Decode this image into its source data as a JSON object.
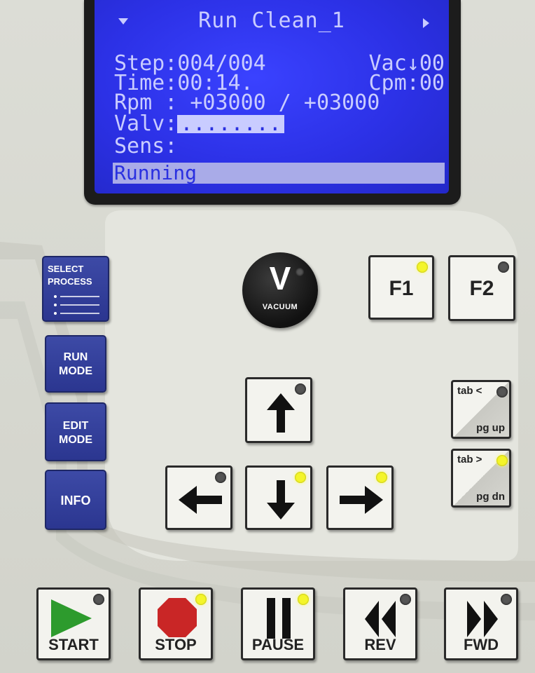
{
  "display": {
    "title": "Run Clean_1",
    "step_label": "Step:004/004",
    "vac_label": "Vac↓00",
    "time_label": "Time:00:14.",
    "cpm_label": "Cpm:00",
    "rpm_label": "Rpm : +03000 / +03000",
    "valv_label": "Valv:",
    "valv_value": "........",
    "sens_label": "Sens:",
    "status": "Running"
  },
  "side_keys": {
    "select_process": [
      "SELECT",
      "PROCESS"
    ],
    "run_mode": [
      "RUN",
      "MODE"
    ],
    "edit_mode": [
      "EDIT",
      "MODE"
    ],
    "info": "INFO"
  },
  "vacuum": {
    "symbol": "V",
    "label": "VACUUM"
  },
  "function_keys": {
    "f1": "F1",
    "f2": "F2"
  },
  "tab_keys": {
    "tab_prev": "tab <",
    "pg_up": "pg up",
    "tab_next": "tab >",
    "pg_dn": "pg dn"
  },
  "bottom_keys": {
    "start": "START",
    "stop": "STOP",
    "pause": "PAUSE",
    "rev": "REV",
    "fwd": "FWD"
  },
  "leds": {
    "f1": "on",
    "f2": "off",
    "arrow_up": "off",
    "arrow_left": "off",
    "arrow_down": "on",
    "arrow_right": "on",
    "tab_prev": "off",
    "tab_next": "on",
    "start": "off",
    "stop": "on",
    "pause": "on",
    "rev": "off",
    "fwd": "off"
  },
  "colors": {
    "lcd_background": "#2c31e6",
    "lcd_text": "#c9ccff",
    "blue_key": "#2b3690",
    "led_on": "#f4f52a",
    "start_triangle": "#2d9b2d",
    "stop_octagon": "#c92626"
  }
}
